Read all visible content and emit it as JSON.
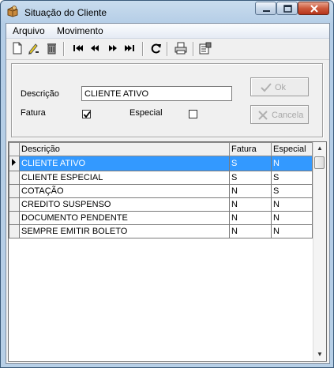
{
  "window": {
    "title": "Situação do Cliente",
    "controls": {
      "minimize": "minimize",
      "maximize": "maximize",
      "close": "close"
    }
  },
  "menu": {
    "items": [
      "Arquivo",
      "Movimento"
    ]
  },
  "toolbar": {
    "buttons": [
      "new-icon",
      "edit-icon",
      "delete-icon",
      "first-record-icon",
      "previous-record-icon",
      "next-record-icon",
      "last-record-icon",
      "refresh-icon",
      "print-icon",
      "properties-icon"
    ]
  },
  "form": {
    "descricao_label": "Descrição",
    "descricao_value": "CLIENTE ATIVO",
    "fatura_label": "Fatura",
    "fatura_checked": true,
    "especial_label": "Especial",
    "especial_checked": false,
    "ok_label": "Ok",
    "cancel_label": "Cancela"
  },
  "grid": {
    "columns": [
      "Descrição",
      "Fatura",
      "Especial"
    ],
    "rows": [
      {
        "descricao": "CLIENTE ATIVO",
        "fatura": "S",
        "especial": "N"
      },
      {
        "descricao": "CLIENTE ESPECIAL",
        "fatura": "S",
        "especial": "S"
      },
      {
        "descricao": "COTAÇÃO",
        "fatura": "N",
        "especial": "S"
      },
      {
        "descricao": "CREDITO SUSPENSO",
        "fatura": "N",
        "especial": "N"
      },
      {
        "descricao": "DOCUMENTO PENDENTE",
        "fatura": "N",
        "especial": "N"
      },
      {
        "descricao": "SEMPRE EMITIR BOLETO",
        "fatura": "N",
        "especial": "N"
      }
    ],
    "selected_row": 0
  },
  "colors": {
    "selection": "#3399ff",
    "title_gradient": "#c9dcee"
  }
}
